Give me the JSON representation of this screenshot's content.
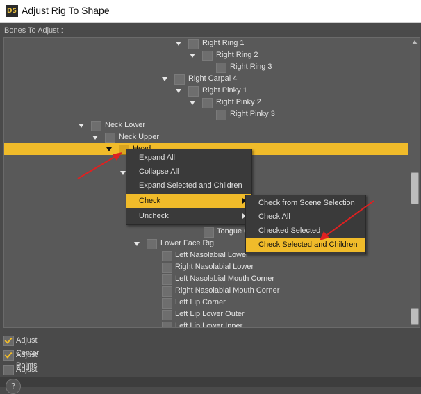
{
  "window": {
    "title": "Adjust Rig To Shape",
    "logo_text": "DS"
  },
  "tree": {
    "label": "Bones To Adjust :",
    "rows": [
      {
        "label": "Right Ring 1",
        "arrow": true,
        "checked": false
      },
      {
        "label": "Right Ring 2",
        "arrow": true,
        "checked": false
      },
      {
        "label": "Right Ring 3",
        "arrow": false,
        "checked": false
      },
      {
        "label": "Right Carpal 4",
        "arrow": true,
        "checked": false
      },
      {
        "label": "Right Pinky 1",
        "arrow": true,
        "checked": false
      },
      {
        "label": "Right Pinky 2",
        "arrow": true,
        "checked": false
      },
      {
        "label": "Right Pinky 3",
        "arrow": false,
        "checked": false
      },
      {
        "label": "Neck Lower",
        "arrow": true,
        "checked": false
      },
      {
        "label": "Neck Upper",
        "arrow": true,
        "checked": false
      },
      {
        "label": "Head",
        "arrow": true,
        "checked": false,
        "selected": true
      },
      {
        "label": "Tongue 0",
        "arrow": false,
        "checked": false
      },
      {
        "label": "Lower Face Rig",
        "arrow": true,
        "checked": false
      },
      {
        "label": "Left Nasolabial Lower",
        "arrow": false,
        "checked": false
      },
      {
        "label": "Right Nasolabial Lower",
        "arrow": false,
        "checked": false
      },
      {
        "label": "Left Nasolabial Mouth Corner",
        "arrow": false,
        "checked": false
      },
      {
        "label": "Right Nasolabial Mouth Corner",
        "arrow": false,
        "checked": false
      },
      {
        "label": "Left Lip Corner",
        "arrow": false,
        "checked": false
      },
      {
        "label": "Left Lip Lower Outer",
        "arrow": false,
        "checked": false
      },
      {
        "label": "Left Lip Lower Inner",
        "arrow": false,
        "checked": false
      }
    ]
  },
  "context_menu": {
    "items": [
      {
        "label": "Expand All"
      },
      {
        "label": "Collapse All"
      },
      {
        "label": "Expand Selected and Children"
      },
      {
        "label": "Check",
        "submenu": true,
        "highlighted": true
      },
      {
        "label": "Uncheck",
        "submenu": true
      }
    ]
  },
  "submenu": {
    "items": [
      {
        "label": "Check from Scene Selection"
      },
      {
        "label": "Check All"
      },
      {
        "label": "Checked Selected"
      },
      {
        "label": "Check Selected and Children",
        "highlighted": true
      }
    ]
  },
  "options": [
    {
      "label": "Adjust Center Points",
      "checked": true
    },
    {
      "label": "Adjust End Points",
      "checked": true
    },
    {
      "label": "Adjust Orientation",
      "checked": false
    }
  ],
  "help": {
    "label": "?"
  },
  "colors": {
    "accent": "#f0bb2a",
    "panel": "#595959",
    "background": "#4a4a4a",
    "annotation": "#e02020"
  }
}
